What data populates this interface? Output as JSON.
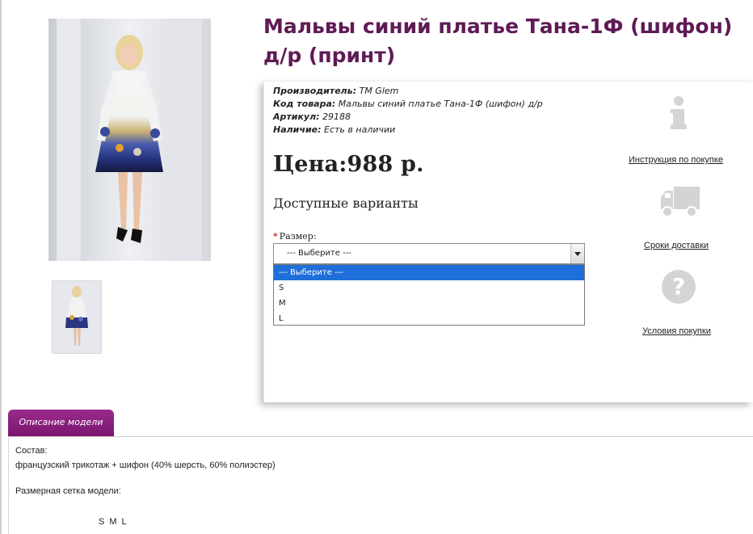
{
  "product": {
    "title": "Мальвы синий платье Тана-1Ф (шифон) д/р (принт)",
    "main_image_alt": "Платье",
    "meta": [
      {
        "key": "Производитель:",
        "value": "ТМ Glem"
      },
      {
        "key": "Код товара:",
        "value": "Мальвы синий платье Тана-1Ф (шифон) д/р"
      },
      {
        "key": "Артикул:",
        "value": "29188"
      },
      {
        "key": "Наличие:",
        "value": "Есть в наличии"
      }
    ],
    "price": "Цена:988 р.",
    "variants_heading": "Доступные варианты",
    "size_label": "Размер:",
    "size_required_mark": "*",
    "size_select": {
      "selected": "--- Выберите ---",
      "options": [
        "--- Выберите ---",
        "S",
        "M",
        "L"
      ]
    }
  },
  "side": {
    "info_link": "Инструкция по покупке",
    "delivery_link": "Сроки доставки",
    "terms_link": "Условия покупки",
    "info_icon": "info-icon",
    "truck_icon": "truck-icon",
    "question_icon": "question-icon"
  },
  "tabs": {
    "description_label": "Описание модели"
  },
  "description": {
    "composition_label": "Состав:",
    "composition_value": "французский трикотаж + шифон (40% шерсть, 60% полиэстер)",
    "size_grid_label": "Размерная сетка модели:",
    "sizes": [
      "S",
      "M",
      "L"
    ]
  },
  "colors": {
    "title": "#5f1a55",
    "tab": "#8a2080",
    "selected_option": "#1e6fd9",
    "required": "#e21d1d"
  }
}
